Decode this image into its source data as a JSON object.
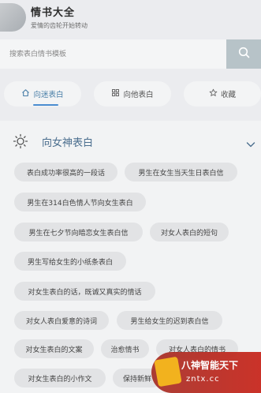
{
  "header": {
    "title": "情书大全",
    "subtitle": "爱情的齿轮开始转动"
  },
  "search": {
    "placeholder": "搜索表白情书模板"
  },
  "tabs": [
    {
      "label": "向迷表白",
      "active": true
    },
    {
      "label": "向他表白",
      "active": false
    },
    {
      "label": "收藏",
      "active": false
    }
  ],
  "panel": {
    "title": "向女神表白"
  },
  "chips": [
    "表白成功率很高的一段话",
    "男生在女生当天生日表白信",
    "男生在314白色情人节向女生表白",
    "男生在七夕节向暗恋女生表白信",
    "对女人表白的短句",
    "男生写给女生的小纸条表白",
    "对女生表白的话，既诚又真实的情话",
    "对女人表白爱意的诗词",
    "男生给女生的迟到表白信",
    "对女生表白的文案",
    "治愈情书",
    "对女人表白的情书",
    "对女生表白的小作文",
    "保持新鲜"
  ],
  "watermark": {
    "line1": "八神智能天下",
    "line2": "zntx.cc"
  },
  "colors": {
    "accent": "#4a7fa8",
    "background": "#ebecef",
    "search_button": "#b7c3c8"
  }
}
